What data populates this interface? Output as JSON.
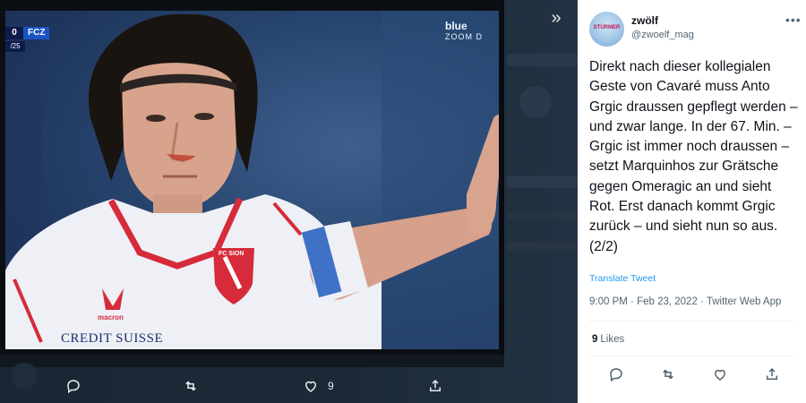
{
  "video": {
    "score_value": "0",
    "score_team": "FCZ",
    "match_time": "/25",
    "channel_line1": "blue",
    "channel_line2": "ZOOM D",
    "crest_text": "FC SION",
    "sponsor": "CREDIT SUISSE",
    "sleeve_brand": "macron"
  },
  "media_bar": {
    "like_count": "9"
  },
  "tweet": {
    "display_name": "zwölf",
    "handle": "@zwoelf_mag",
    "text": "Direkt nach dieser kollegialen Geste von Cavaré muss Anto Grgic draussen gepflegt werden – und zwar lange. In der 67. Min. – Grgic ist immer noch draussen – setzt Marquinhos zur Grätsche gegen Omeragic an und sieht Rot. Erst danach kommt Grgic zurück – und sieht nun so aus. (2/2)",
    "translate_label": "Translate Tweet",
    "time": "9:00 PM",
    "date": "Feb 23, 2022",
    "source": "Twitter Web App",
    "separator": " · ",
    "likes_count": "9",
    "likes_label": "Likes",
    "avatar_text": "STÜRMER"
  },
  "icons": {
    "collapse": "double-chevron-right-icon",
    "reply": "reply-icon",
    "retweet": "retweet-icon",
    "like": "heart-icon",
    "share": "share-icon",
    "more": "more-icon"
  },
  "colors": {
    "link": "#1d9bf0",
    "panel_bg": "#ffffff",
    "viewer_bg": "#15202b",
    "muted_text": "#536471"
  }
}
